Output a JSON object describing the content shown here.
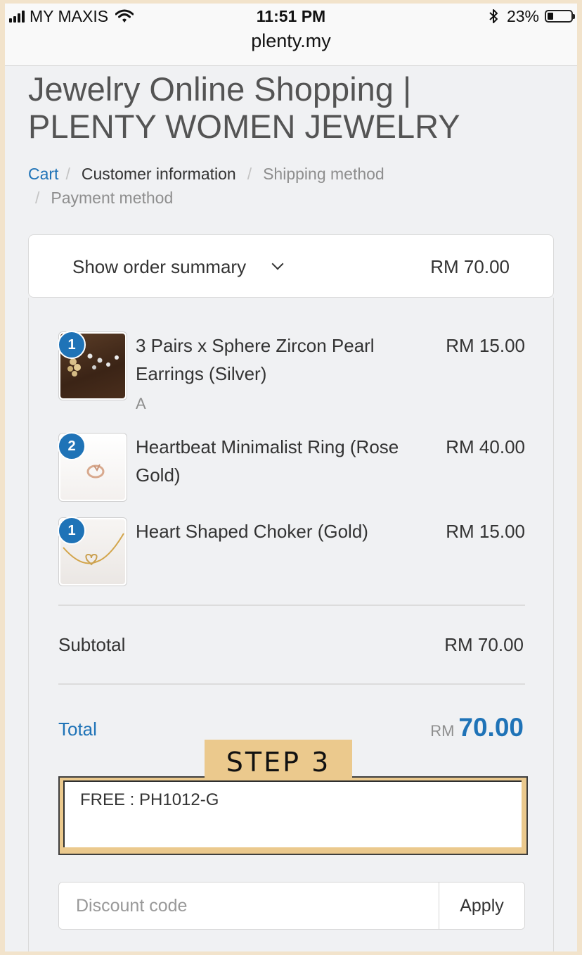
{
  "status_bar": {
    "carrier": "MY MAXIS",
    "time": "11:51 PM",
    "battery": "23%",
    "battery_level": 0.23,
    "url": "plenty.my"
  },
  "shop_title": "Jewelry Online Shopping | PLENTY WOMEN JEWELRY",
  "breadcrumb": {
    "cart": "Cart",
    "customer_information": "Customer information",
    "shipping_method": "Shipping method",
    "payment_method": "Payment method",
    "separator": "/"
  },
  "order_summary": {
    "toggle_label": "Show order summary",
    "toggle_total": "RM 70.00",
    "items": [
      {
        "qty": "1",
        "name": "3 Pairs x Sphere Zircon Pearl Earrings (Silver)",
        "variant": "A",
        "price": "RM 15.00"
      },
      {
        "qty": "2",
        "name": "Heartbeat Minimalist Ring (Rose Gold)",
        "variant": "",
        "price": "RM 40.00"
      },
      {
        "qty": "1",
        "name": "Heart Shaped Choker (Gold)",
        "variant": "",
        "price": "RM 15.00"
      }
    ],
    "subtotal_label": "Subtotal",
    "subtotal_value": "RM 70.00",
    "total_label": "Total",
    "total_currency": "RM",
    "total_amount": "70.00"
  },
  "annotation": {
    "step_label": "STEP 3",
    "code_text": "FREE : PH1012-G"
  },
  "discount": {
    "placeholder": "Discount code",
    "apply_label": "Apply"
  },
  "colors": {
    "accent": "#1f73b7",
    "frame": "#f2e3cb",
    "step_highlight": "#ebc98d"
  }
}
